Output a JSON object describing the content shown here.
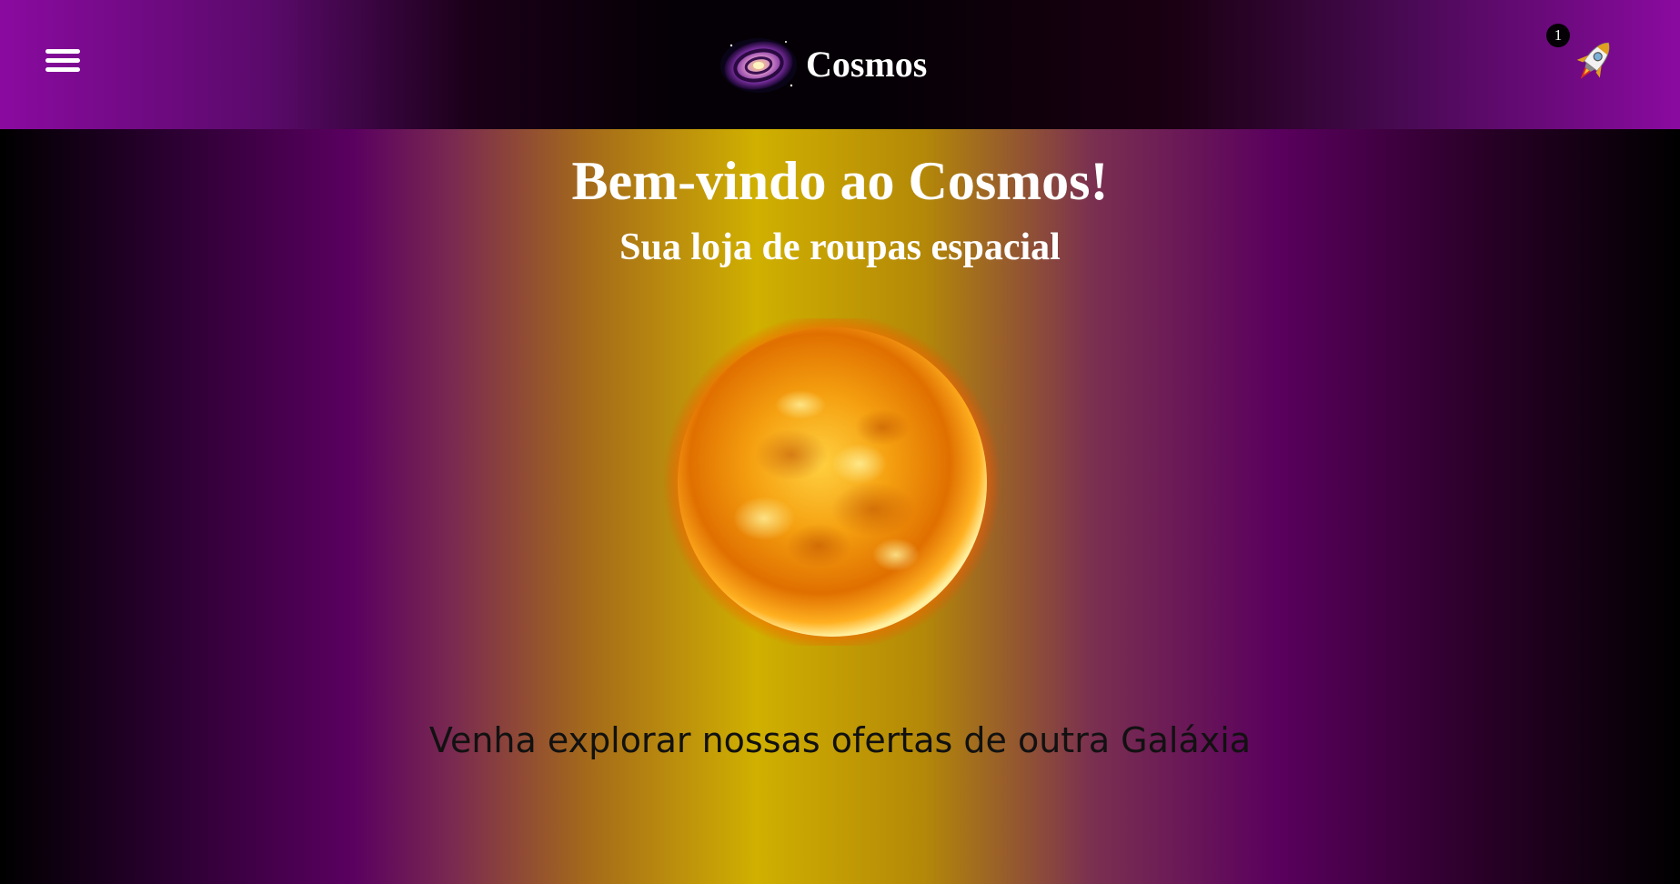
{
  "header": {
    "menu_icon": "hamburger-menu-icon",
    "brand": {
      "logo_icon": "galaxy-icon",
      "name": "Cosmos"
    },
    "cart": {
      "icon": "rocket-icon",
      "count": "1"
    }
  },
  "hero": {
    "title": "Bem-vindo ao Cosmos!",
    "subtitle": "Sua loja de roupas espacial",
    "image": "sun-image",
    "tagline": "Venha explorar nossas ofertas de outra Galáxia"
  },
  "colors": {
    "header_purple": "#8a0aa0",
    "hero_gold": "#d0b000",
    "hero_purple": "#5a0060",
    "text_white": "#ffffff",
    "tagline_text": "#111111"
  }
}
